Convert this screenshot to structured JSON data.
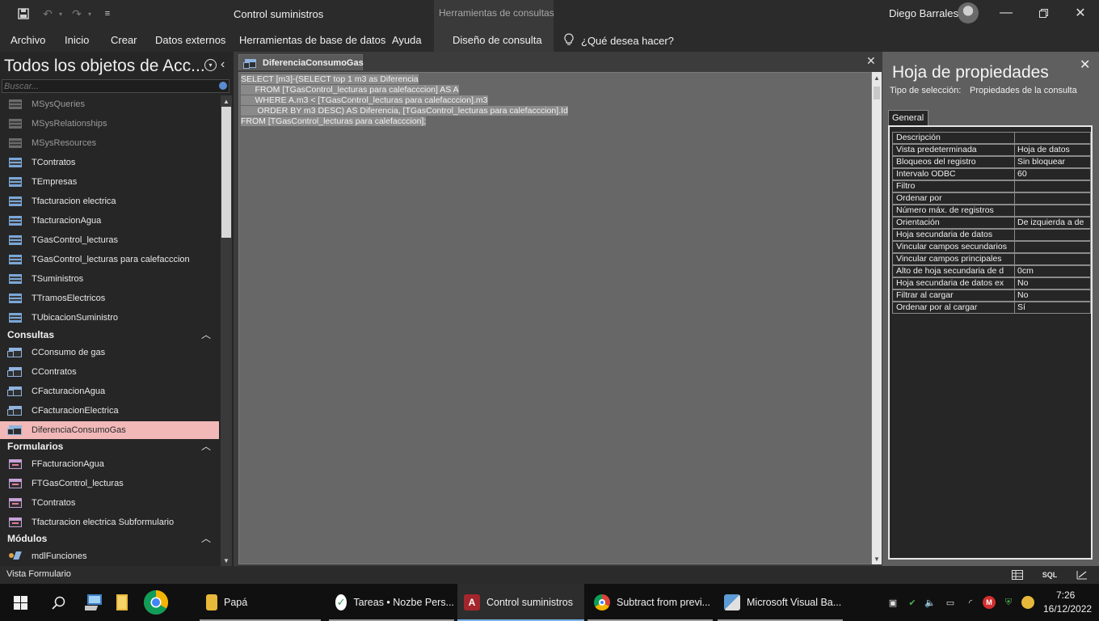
{
  "titlebar": {
    "app_title": "Control suministros",
    "context_title": "Herramientas de consultas",
    "user_name": "Diego Barrales",
    "save_icon": "save-icon",
    "undo_icon": "undo-icon",
    "redo_icon": "redo-icon"
  },
  "ribbon": {
    "tabs": [
      {
        "label": "Archivo"
      },
      {
        "label": "Inicio"
      },
      {
        "label": "Crear"
      },
      {
        "label": "Datos externos"
      },
      {
        "label": "Herramientas de base de datos"
      },
      {
        "label": "Ayuda"
      },
      {
        "label": "Diseño de consulta"
      }
    ],
    "tell_me": "¿Qué desea hacer?"
  },
  "nav": {
    "title": "Todos los objetos de Acc...",
    "search_placeholder": "Buscar...",
    "tables": [
      "MSysQueries",
      "MSysRelationships",
      "MSysResources",
      "TContratos",
      "TEmpresas",
      "Tfacturacion electrica",
      "TfacturacionAgua",
      "TGasControl_lecturas",
      "TGasControl_lecturas para calefacccion",
      "TSuministros",
      "TTramosElectricos",
      "TUbicacionSuministro"
    ],
    "groups": {
      "queries": "Consultas",
      "forms": "Formularios",
      "modules": "Módulos"
    },
    "queries": [
      "CConsumo de gas",
      "CContratos",
      "CFacturacionAgua",
      "CFacturacionElectrica",
      "DiferenciaConsumoGas"
    ],
    "forms": [
      "FFacturacionAgua",
      "FTGasControl_lecturas",
      "TContratos",
      "Tfacturacion electrica Subformulario"
    ],
    "modules": [
      "mdlFunciones"
    ]
  },
  "document": {
    "tab_label": "DiferenciaConsumoGas",
    "sql": [
      "SELECT [m3]-(SELECT top 1 m3 as Diferencia",
      "      FROM [TGasControl_lecturas para calefacccion] AS A",
      "      WHERE A.m3 < [TGasControl_lecturas para calefacccion].m3",
      "       ORDER BY m3 DESC) AS Diferencia, [TGasControl_lecturas para calefacccion].Id",
      "FROM [TGasControl_lecturas para calefacccion];"
    ]
  },
  "properties": {
    "title": "Hoja de propiedades",
    "selection_label": "Tipo de selección:",
    "selection_value": "Propiedades de la consulta",
    "tab": "General",
    "rows": [
      {
        "key": "Descripción",
        "value": ""
      },
      {
        "key": "Vista predeterminada",
        "value": "Hoja de datos"
      },
      {
        "key": "Bloqueos del registro",
        "value": "Sin bloquear"
      },
      {
        "key": "Intervalo ODBC",
        "value": "60"
      },
      {
        "key": "Filtro",
        "value": ""
      },
      {
        "key": "Ordenar por",
        "value": ""
      },
      {
        "key": "Número máx. de registros",
        "value": ""
      },
      {
        "key": "Orientación",
        "value": "De izquierda a de"
      },
      {
        "key": "Hoja secundaria de datos",
        "value": ""
      },
      {
        "key": "Vincular campos secundarios",
        "value": ""
      },
      {
        "key": "Vincular campos principales",
        "value": ""
      },
      {
        "key": "Alto de hoja secundaria de d",
        "value": "0cm"
      },
      {
        "key": "Hoja secundaria de datos ex",
        "value": "No"
      },
      {
        "key": "Filtrar al cargar",
        "value": "No"
      },
      {
        "key": "Ordenar por al cargar",
        "value": "Sí"
      }
    ]
  },
  "statusbar": {
    "text": "Vista Formulario",
    "sql_view": "SQL"
  },
  "taskbar": {
    "apps": [
      {
        "label": "Papá",
        "icon": "folder-icon"
      },
      {
        "label": "Tareas • Nozbe Pers...",
        "icon": "nozbe-icon"
      },
      {
        "label": "Control suministros",
        "icon": "access-icon"
      },
      {
        "label": "Subtract from previ...",
        "icon": "chrome-icon"
      },
      {
        "label": "Microsoft Visual Ba...",
        "icon": "vba-icon"
      }
    ],
    "time": "7:26",
    "date": "16/12/2022"
  }
}
